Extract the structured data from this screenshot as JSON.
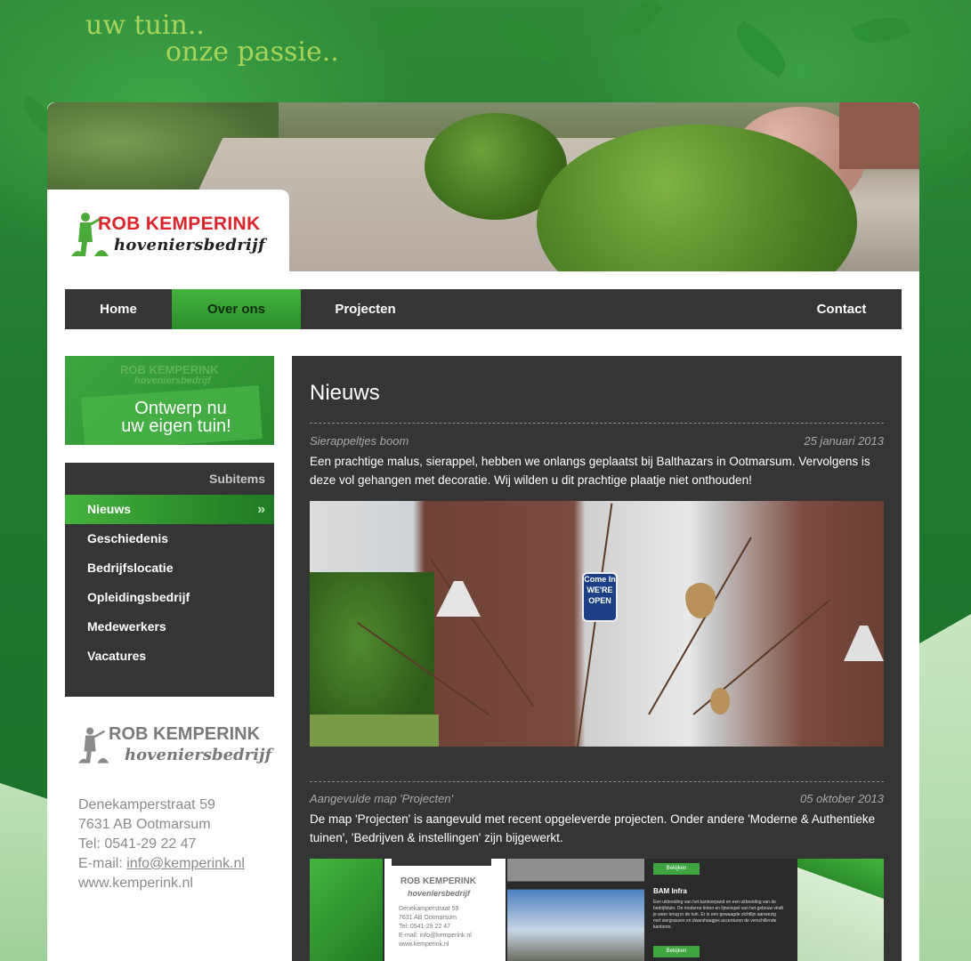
{
  "slogan": {
    "line1": "uw tuin..",
    "line2": "onze passie.."
  },
  "brand": {
    "name": "ROB KEMPERINK",
    "subtitle": "hoveniersbedrijf"
  },
  "nav": {
    "items": [
      {
        "label": "Home"
      },
      {
        "label": "Over ons",
        "active": true
      },
      {
        "label": "Projecten"
      },
      {
        "label": "Contact"
      }
    ]
  },
  "promo": {
    "ghost_name": "ROB KEMPERINK",
    "ghost_sub": "hoveniersbedrijf",
    "line1": "Ontwerp nu",
    "line2": "uw eigen tuin!"
  },
  "subnav": {
    "title": "Subitems",
    "items": [
      {
        "label": "Nieuws",
        "active": true,
        "arrow": "»"
      },
      {
        "label": "Geschiedenis"
      },
      {
        "label": "Bedrijfslocatie"
      },
      {
        "label": "Opleidingsbedrijf"
      },
      {
        "label": "Medewerkers"
      },
      {
        "label": "Vacatures"
      }
    ]
  },
  "address": {
    "street": "Denekamperstraat 59",
    "city": "7631 AB Ootmarsum",
    "phone": "Tel: 0541-29 22 47",
    "email_label": "E-mail:",
    "email": "info@kemperink.nl",
    "web": "www.kemperink.nl"
  },
  "content": {
    "heading": "Nieuws",
    "news": [
      {
        "title": "Sierappeltjes boom",
        "date": "25 januari 2013",
        "body": "Een prachtige malus, sierappel, hebben we onlangs geplaatst bij Balthazars in Ootmarsum. Vervolgens is deze vol gehangen met decoratie. Wij wilden u dit prachtige plaatje niet onthouden!",
        "image_sign": [
          "Come In",
          "WE'RE",
          "OPEN"
        ]
      },
      {
        "title": "Aangevulde map 'Projecten'",
        "date": "05 oktober 2013",
        "body": "De map 'Projecten' is aangevuld met recent opgeleverde projecten. Onder andere 'Moderne & Authentieke tuinen', 'Bedrijven & instellingen' zijn bijgewerkt.",
        "preview": {
          "logo_name": "ROB KEMPERINK",
          "logo_sub": "hoveniersbedrijf",
          "addr": [
            "Denekamperstraat 59",
            "7631 AB Ootmarsum",
            "Tel: 0541-29 22 47",
            "E-mail: info@kemperink.nl",
            "www.kemperink.nl"
          ],
          "button": "Bekijken",
          "project_title": "BAM Infra",
          "project_text": "Een uitbreiding van het kantoorpand en een uitbreiding van de bedrijfstuin. De moderne tinten en lijnenspel van het gebouw vindt je weer terug in de tuin. Er is een gewaagde zichtlijn aanwezig met siergrassen en dwarshaagjes accenturen de verschillende kantoren."
        }
      }
    ]
  },
  "colors": {
    "accent_green": "#45b33e",
    "dark_panel": "#353535",
    "logo_red": "#d9252b"
  }
}
